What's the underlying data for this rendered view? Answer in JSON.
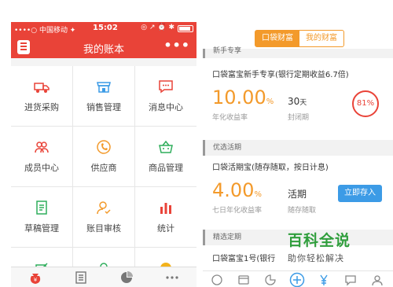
{
  "status_bar": {
    "carrier": "••••○ 中国移动 ✦",
    "time": "15:02",
    "icons": "◎ ↗ ⏰ ✱"
  },
  "nav": {
    "title": "我的账本",
    "more": "•••"
  },
  "grid": [
    {
      "label": "进货采购",
      "icon": "truck-icon",
      "color": "#e94338"
    },
    {
      "label": "销售管理",
      "icon": "shop-icon",
      "color": "#3c9be6"
    },
    {
      "label": "消息中心",
      "icon": "message-icon",
      "color": "#e94338"
    },
    {
      "label": "成员中心",
      "icon": "members-icon",
      "color": "#e94338"
    },
    {
      "label": "供应商",
      "icon": "supplier-icon",
      "color": "#f39a2b"
    },
    {
      "label": "商品管理",
      "icon": "basket-icon",
      "color": "#2fae5c"
    },
    {
      "label": "草稿管理",
      "icon": "draft-icon",
      "color": "#2fae5c"
    },
    {
      "label": "账目审核",
      "icon": "audit-icon",
      "color": "#f39a2b"
    },
    {
      "label": "统计",
      "icon": "bar-chart-icon",
      "color": "#e94338"
    }
  ],
  "left_tabs": [
    "ledger-bag-icon",
    "list-icon",
    "pie-icon",
    "more-dots-icon"
  ],
  "right": {
    "segment": {
      "active": "口袋财富",
      "inactive": "我的财富"
    },
    "top_section_cut": "新手专享",
    "product1": {
      "name": "口袋富宝新手专享(银行定期收益6.7倍)",
      "rate": "10.00",
      "rate_unit": "%",
      "rate_label": "年化收益率",
      "term": "30",
      "term_unit": "天",
      "term_label": "封闭期",
      "progress": "81%"
    },
    "section2": "优选活期",
    "product2": {
      "name": "口袋活期宝(随存随取，按日计息)",
      "rate": "4.00",
      "rate_unit": "%",
      "rate_label": "七日年化收益率",
      "term": "活期",
      "term_label": "随存随取",
      "button": "立即存入"
    },
    "section3": "精选定期",
    "product3": {
      "name": "口袋富宝1号(银行"
    },
    "watermark": {
      "title": "百科全说",
      "subtitle": "助你轻松解决"
    }
  }
}
